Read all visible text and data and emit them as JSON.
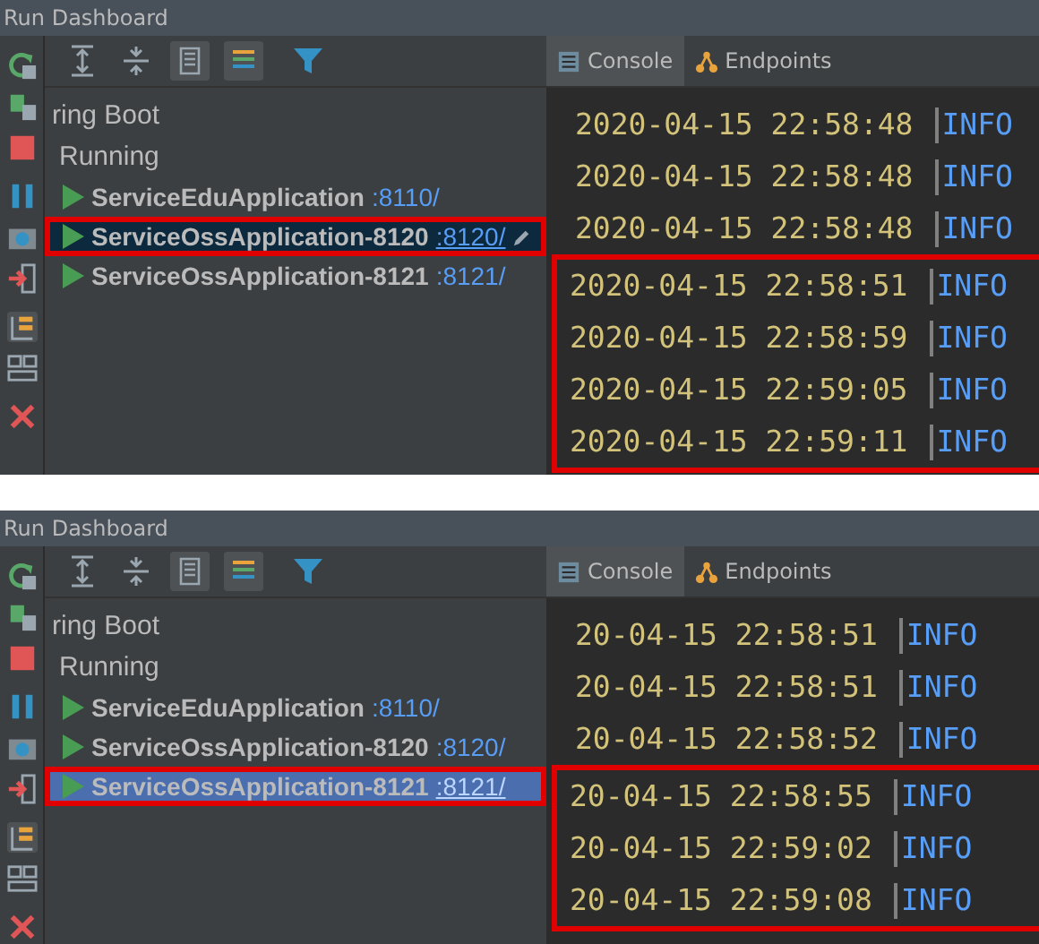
{
  "panels": [
    {
      "title": "Run Dashboard",
      "tree_focused": false,
      "tabs": [
        {
          "label": "Console",
          "kind": "console",
          "selected": true
        },
        {
          "label": "Endpoints",
          "kind": "endpoints",
          "selected": false
        }
      ],
      "tree": [
        {
          "label": "ring Boot",
          "children": [
            {
              "label": "Running",
              "children": [
                {
                  "name": "ServiceEduApplication",
                  "port": ":8110/",
                  "selected": false,
                  "highlighted": false,
                  "edit": false
                },
                {
                  "name": "ServiceOssApplication-8120",
                  "port": ":8120/",
                  "selected": true,
                  "highlighted": true,
                  "edit": true
                },
                {
                  "name": "ServiceOssApplication-8121",
                  "port": ":8121/",
                  "selected": false,
                  "highlighted": false,
                  "edit": false
                }
              ]
            }
          ]
        }
      ],
      "log": [
        {
          "time": "2020-04-15 22:58:48",
          "level": "INFO",
          "highlighted": false
        },
        {
          "time": "2020-04-15 22:58:48",
          "level": "INFO",
          "highlighted": false
        },
        {
          "time": "2020-04-15 22:58:48",
          "level": "INFO",
          "highlighted": false
        },
        {
          "time": "2020-04-15 22:58:51",
          "level": "INFO",
          "highlighted": true
        },
        {
          "time": "2020-04-15 22:58:59",
          "level": "INFO",
          "highlighted": true
        },
        {
          "time": "2020-04-15 22:59:05",
          "level": "INFO",
          "highlighted": true
        },
        {
          "time": "2020-04-15 22:59:11",
          "level": "INFO",
          "highlighted": true
        }
      ]
    },
    {
      "title": "Run Dashboard",
      "tree_focused": true,
      "tabs": [
        {
          "label": "Console",
          "kind": "console",
          "selected": true
        },
        {
          "label": "Endpoints",
          "kind": "endpoints",
          "selected": false
        }
      ],
      "tree": [
        {
          "label": "ring Boot",
          "children": [
            {
              "label": "Running",
              "children": [
                {
                  "name": "ServiceEduApplication",
                  "port": ":8110/",
                  "selected": false,
                  "highlighted": false,
                  "edit": false
                },
                {
                  "name": "ServiceOssApplication-8120",
                  "port": ":8120/",
                  "selected": false,
                  "highlighted": false,
                  "edit": false
                },
                {
                  "name": "ServiceOssApplication-8121",
                  "port": ":8121/",
                  "selected": true,
                  "highlighted": true,
                  "edit": false
                }
              ]
            }
          ]
        }
      ],
      "log": [
        {
          "time": "20-04-15 22:58:51",
          "level": "INFO",
          "highlighted": false
        },
        {
          "time": "20-04-15 22:58:51",
          "level": "INFO",
          "highlighted": false
        },
        {
          "time": "20-04-15 22:58:52",
          "level": "INFO",
          "highlighted": false
        },
        {
          "time": "20-04-15 22:58:55",
          "level": "INFO",
          "highlighted": true
        },
        {
          "time": "20-04-15 22:59:02",
          "level": "INFO",
          "highlighted": true
        },
        {
          "time": "20-04-15 22:59:08",
          "level": "INFO",
          "highlighted": true
        }
      ]
    }
  ]
}
